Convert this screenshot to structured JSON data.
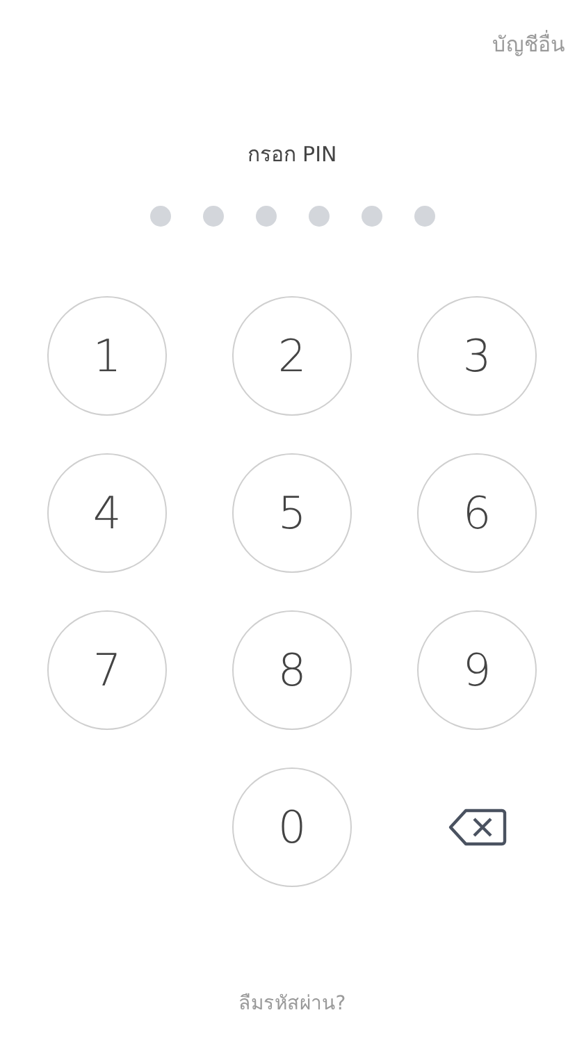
{
  "top_link": "บัญชีอื่น",
  "title": "กรอก PIN",
  "pin_dots": [
    {
      "filled": false
    },
    {
      "filled": false
    },
    {
      "filled": false
    },
    {
      "filled": false
    },
    {
      "filled": false
    },
    {
      "filled": false
    }
  ],
  "keypad": [
    {
      "kind": "digit",
      "label": "1"
    },
    {
      "kind": "digit",
      "label": "2"
    },
    {
      "kind": "digit",
      "label": "3"
    },
    {
      "kind": "digit",
      "label": "4"
    },
    {
      "kind": "digit",
      "label": "5"
    },
    {
      "kind": "digit",
      "label": "6"
    },
    {
      "kind": "digit",
      "label": "7"
    },
    {
      "kind": "digit",
      "label": "8"
    },
    {
      "kind": "digit",
      "label": "9"
    },
    {
      "kind": "blank"
    },
    {
      "kind": "digit",
      "label": "0"
    },
    {
      "kind": "backspace"
    }
  ],
  "forgot_link": "ลืมรหัสผ่าน?"
}
